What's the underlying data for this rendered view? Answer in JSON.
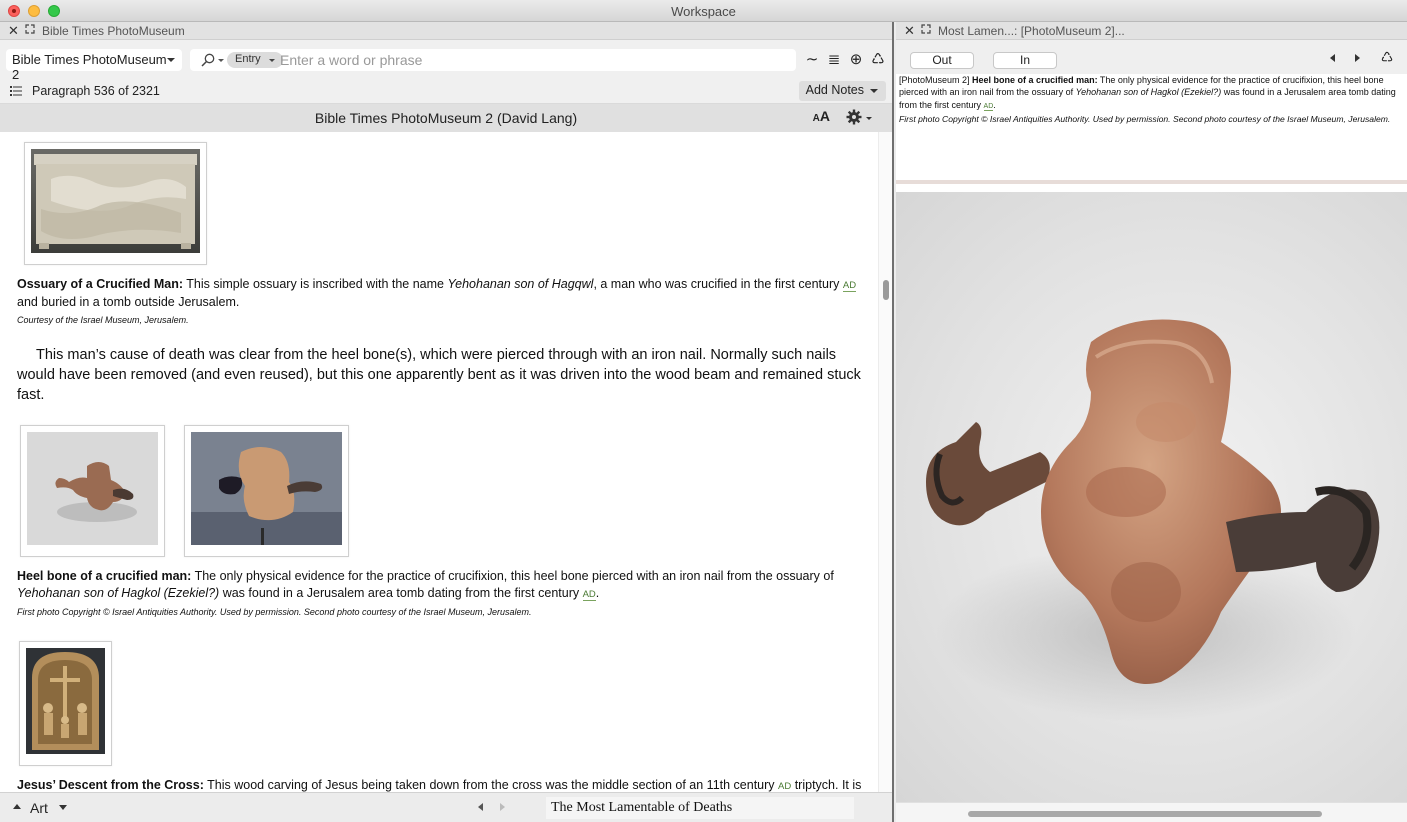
{
  "window": {
    "title": "Workspace"
  },
  "left_panel": {
    "tab_title": "Bible Times PhotoMuseum",
    "resource_selector": "Bible Times PhotoMuseum 2",
    "search": {
      "scope": "Entry",
      "placeholder": "Enter a word or phrase"
    },
    "toolbar_icons": [
      "wave-icon",
      "list-lines-icon",
      "add-circle-icon",
      "recycle-icon"
    ],
    "paragraph_label": "Paragraph 536 of 2321",
    "add_notes_label": "Add Notes",
    "document_title": "Bible Times PhotoMuseum 2 (David Lang)",
    "font_size_label": "AA",
    "entries": {
      "ossuary": {
        "caption_bold": "Ossuary of a Crucified Man:",
        "caption_text_1": " This simple ossuary is inscribed with the name ",
        "caption_italic": "Yehohanan son of Hagqwl",
        "caption_text_2": ", a man who was crucified in the first century ",
        "ad": "AD",
        "caption_text_3": " and buried in a tomb outside Jerusalem.",
        "credit": "Courtesy of the Israel Museum, Jerusalem."
      },
      "body_paragraph": "This man’s cause of death was clear from the heel bone(s), which were pierced through with an iron nail. Normally such nails would have been removed (and even reused), but this one apparently bent as it was driven into the wood beam and remained stuck fast.",
      "heel": {
        "caption_bold": "Heel bone of a crucified man:",
        "caption_text_1": " The only physical evidence for the practice of crucifixion, this heel bone pierced with an iron nail from the ossuary of ",
        "caption_italic": "Yehohanan son of Hagkol (Ezekiel?)",
        "caption_text_2": " was found in a Jerusalem area tomb dating from the first century ",
        "ad": "AD",
        "caption_text_3": ".",
        "credit": "First photo Copyright © Israel Antiquities Authority. Used by permission. Second photo courtesy of the Israel Museum, Jerusalem."
      },
      "descent": {
        "caption_bold": "Jesus’ Descent from the Cross:",
        "caption_text_1": " This wood carving of Jesus being taken down from the cross was the middle section of an 11th century ",
        "ad": "AD",
        "caption_text_2": " triptych. It is interesting in that it shows a man with large tongs removing the nail from Jesus’ feet. The large nails used in crucifixion were typically removed and reused—perhaps the main reason why there is so little archaeological evidence for crucifixion."
      }
    },
    "bottom": {
      "section_label": "Art",
      "section_title": "The Most Lamentable of Deaths"
    }
  },
  "right_panel": {
    "tab_title": "Most Lamen...: [PhotoMuseum 2]...",
    "zoom_out_label": "Out",
    "zoom_in_label": "In",
    "caption_prefix": "[PhotoMuseum 2] ",
    "caption_bold": "Heel bone of a crucified man:",
    "caption_text_1": " The only physical evidence for the practice of crucifixion, this heel bone pierced with an iron nail from the ossuary of ",
    "caption_italic": "Yehohanan son of Hagkol (Ezekiel?)",
    "caption_text_2": " was found in a Jerusalem area tomb dating from the first century ",
    "ad": "AD",
    "caption_text_3": ".",
    "credit": "First photo Copyright © Israel Antiquities Authority. Used by permission. Second photo courtesy of the Israel Museum, Jerusalem."
  },
  "colors": {
    "ad_link": "#4a7a33",
    "panel_divider": "#6f6f6f",
    "close_button": "#fc605c",
    "minimize_button": "#fdbc40",
    "zoom_button": "#34c84a"
  }
}
